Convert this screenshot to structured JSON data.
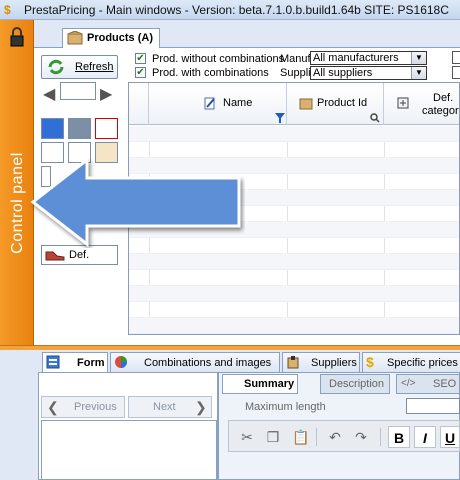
{
  "window": {
    "title": "PrestaPricing - Main windows  -  Version:  beta.7.1.0.b.build1.64b    SITE: PS1618C"
  },
  "control_panel": {
    "label": "Control panel"
  },
  "top_tab": {
    "label": "Products (A)"
  },
  "toolbar": {
    "refresh_label": "Refresh",
    "def_label": "Def."
  },
  "filters": {
    "without_combinations": {
      "label": "Prod. without combinations",
      "checked": true
    },
    "with_combinations": {
      "label": "Prod. with combinations",
      "checked": true
    },
    "manufacturer_label": "Manufacturer",
    "supplier_label": "Supplier",
    "manufacturer_value": "All manufacturers",
    "supplier_value": "All suppliers"
  },
  "grid": {
    "columns": [
      {
        "label": "Name",
        "icon": "pen-icon"
      },
      {
        "label": "Product Id",
        "icon": "box-icon"
      },
      {
        "label": "Def.\ncategory",
        "line1": "Def.",
        "line2": "category",
        "icon": "category-icon"
      }
    ]
  },
  "bottom_tabs": [
    {
      "label": "Form",
      "icon": "form-icon",
      "active": true
    },
    {
      "label": "Combinations and images",
      "icon": "combinations-icon"
    },
    {
      "label": "Suppliers",
      "icon": "supplier-icon"
    },
    {
      "label": "Specific prices",
      "icon": "dollar-icon"
    }
  ],
  "form_nav": {
    "previous_label": "Previous",
    "next_label": "Next"
  },
  "inner_tabs": [
    {
      "label": "Summary",
      "active": true
    },
    {
      "label": "Description"
    },
    {
      "label": "SEO"
    }
  ],
  "summary": {
    "max_length_label": "Maximum length"
  },
  "editor": {
    "bold": "B",
    "italic": "I",
    "underline": "U"
  },
  "colors": {
    "accent_orange": "#f08c1e",
    "arrow_blue": "#5b8fd6",
    "window_bg": "#dfe8f4"
  }
}
